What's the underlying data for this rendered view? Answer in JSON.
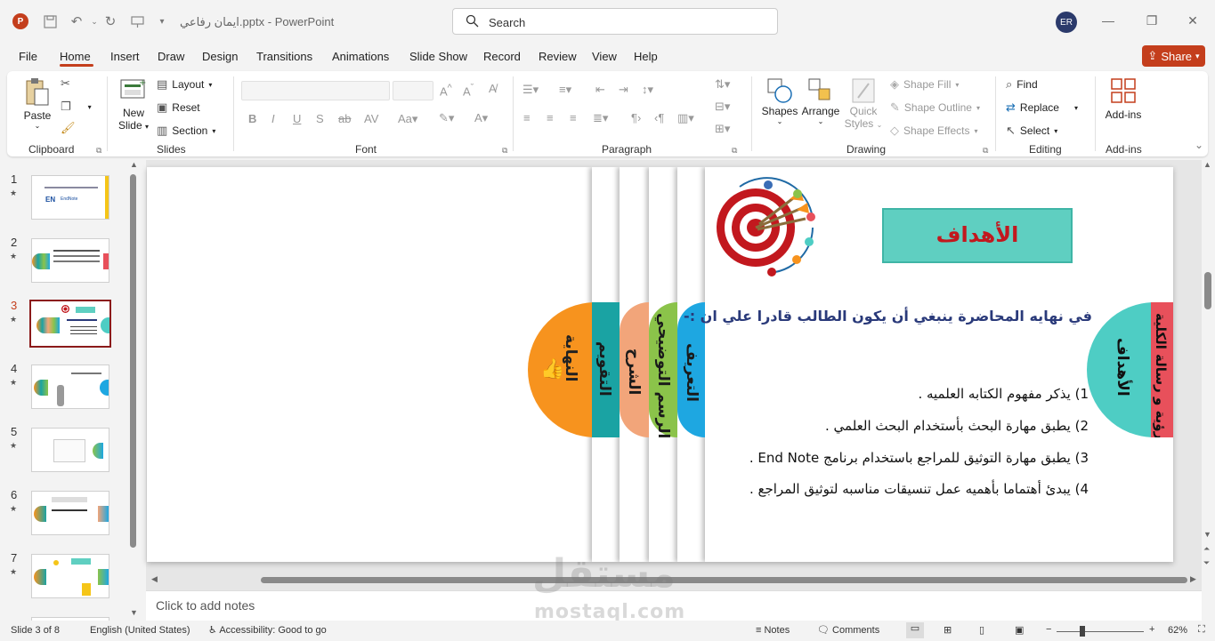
{
  "titlebar": {
    "app_icon": "P",
    "doc_title": "ايمان رفاعي.pptx",
    "app_name": "PowerPoint",
    "title_separator": "-",
    "search_placeholder": "Search",
    "avatar_initials": "ER"
  },
  "menu": {
    "tabs": [
      "File",
      "Home",
      "Insert",
      "Draw",
      "Design",
      "Transitions",
      "Animations",
      "Slide Show",
      "Record",
      "Review",
      "View",
      "Help"
    ],
    "active": "Home",
    "share_label": "Share"
  },
  "ribbon": {
    "clipboard": {
      "label": "Clipboard",
      "paste": "Paste"
    },
    "slides": {
      "label": "Slides",
      "new_slide": "New Slide",
      "new_slide_line1": "New",
      "new_slide_line2": "Slide",
      "layout": "Layout",
      "reset": "Reset",
      "section": "Section"
    },
    "font": {
      "label": "Font"
    },
    "paragraph": {
      "label": "Paragraph"
    },
    "drawing": {
      "label": "Drawing",
      "shapes": "Shapes",
      "arrange": "Arrange",
      "quick_styles": "Quick Styles",
      "quick_line1": "Quick",
      "quick_line2": "Styles",
      "shape_fill": "Shape Fill",
      "shape_outline": "Shape Outline",
      "shape_effects": "Shape Effects"
    },
    "editing": {
      "label": "Editing",
      "find": "Find",
      "replace": "Replace",
      "select": "Select"
    },
    "addins": {
      "label": "Add-ins",
      "button": "Add-ins"
    }
  },
  "thumbnails": {
    "numbers": [
      "1",
      "2",
      "3",
      "4",
      "5",
      "6",
      "7"
    ],
    "active_index": 3,
    "thumb1_text": "EN",
    "thumb1_sub": "EndNote"
  },
  "slide": {
    "banner_title": "الأهداف",
    "intro": "في نهايه المحاضرة ينبغي أن يكون الطالب قادرا علي ان :-",
    "objectives": [
      "1) يذكر مفهوم الكتابه العلميه .",
      "2) يطبق مهارة البحث بأستخدام البحث العلمي .",
      "3) يطبق مهارة  التوثيق للمراجع باستخدام برنامج End Note .",
      "4)  يبدئ أهتماما بأهميه عمل تنسيقات مناسبه لتوثيق المراجع ."
    ],
    "tabs": {
      "vision": "رؤية و رسالة الكلية",
      "objectives": "الأهداف",
      "definition": "التعريف",
      "diagram": "الرسم التوضيحي",
      "explanation": "الشرح",
      "evaluation": "التقويم",
      "end": "النهاية"
    },
    "tab_colors": {
      "vision": "#e8505b",
      "objectives": "#4ecdc4",
      "definition": "#1ea7e1",
      "diagram": "#8bc34a",
      "explanation": "#f2a57a",
      "evaluation": "#1aa3a3",
      "end": "#f7931e"
    }
  },
  "notes": {
    "placeholder": "Click to add notes"
  },
  "watermark": {
    "arabic": "مستقل",
    "latin": "mostaql.com"
  },
  "statusbar": {
    "slide_of": "Slide 3 of 8",
    "language": "English (United States)",
    "accessibility": "Accessibility: Good to go",
    "notes": "Notes",
    "comments": "Comments",
    "zoom_minus": "−",
    "zoom_plus": "+",
    "zoom": "62%",
    "zoom_level": 0.62
  }
}
